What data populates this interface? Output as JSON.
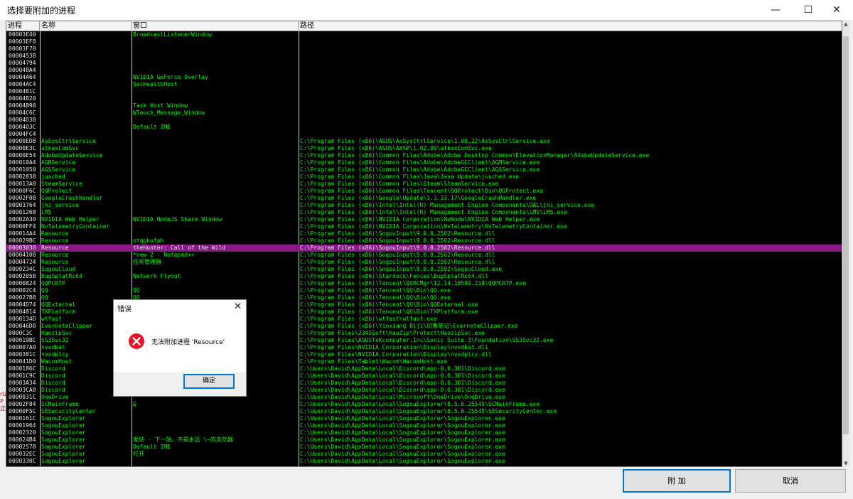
{
  "window": {
    "title": "选择要附加的进程",
    "minimize_glyph": "—",
    "maximize_glyph": "☐",
    "close_glyph": "✕"
  },
  "columns": [
    "进程",
    "名称",
    "窗口",
    "路径"
  ],
  "rows": [
    [
      "00003E40",
      "",
      "BroadcastListenerWindow",
      ""
    ],
    [
      "00003EF8",
      "",
      "",
      ""
    ],
    [
      "00003F70",
      "",
      "",
      ""
    ],
    [
      "00004538",
      "",
      "",
      ""
    ],
    [
      "00004794",
      "",
      "",
      ""
    ],
    [
      "000048A4",
      "",
      "",
      ""
    ],
    [
      "00004A64",
      "",
      "NVIDIA GeForce Overlay",
      ""
    ],
    [
      "00004AC4",
      "",
      "SecHealthHost",
      ""
    ],
    [
      "00004B1C",
      "",
      "",
      ""
    ],
    [
      "00004B20",
      "",
      "",
      ""
    ],
    [
      "00004B98",
      "",
      "Task Host Window",
      ""
    ],
    [
      "00004C6C",
      "",
      "WTouch_Massage_Window",
      ""
    ],
    [
      "00004D38",
      "",
      "",
      ""
    ],
    [
      "00004D3C",
      "",
      "Default IME",
      ""
    ],
    [
      "00004FC4",
      "",
      "",
      ""
    ],
    [
      "00000ED8",
      "AsSysCtrlService",
      "",
      "C:\\Program Files (x86)\\ASUS\\AsSysCtrlService\\1.00.22\\AsSysCtrlService.exe"
    ],
    [
      "00000E3C",
      "atkexComSvc",
      "",
      "C:\\Program Files (x86)\\ASUS\\AXSP\\1.02.00\\atkexComSvc.exe"
    ],
    [
      "00000E54",
      "AdobeUpdateService",
      "",
      "C:\\Program Files (x86)\\Common Files\\Adobe\\Adobe Desktop Common\\ElevationManager\\AdobeUpdateService.exe"
    ],
    [
      "000010A4",
      "AGMService",
      "",
      "C:\\Program Files (x86)\\Common Files\\Adobe\\AdobeGCClient\\AGMService.exe"
    ],
    [
      "00001050",
      "AGSService",
      "",
      "C:\\Program Files (x86)\\Common Files\\Adobe\\AdobeGCClient\\AGSService.exe"
    ],
    [
      "00002838",
      "jusched",
      "",
      "C:\\Program Files (x86)\\Common Files\\Java\\Java Update\\jusched.exe"
    ],
    [
      "000013A0",
      "SteamService",
      "",
      "C:\\Program Files (x86)\\Common Files\\Steam\\SteamService.exe"
    ],
    [
      "00000F6C",
      "QQProtect",
      "",
      "C:\\Program Files (x86)\\Common Files\\Tencent\\QQProtect\\Bin\\QQProtect.exe"
    ],
    [
      "00002F08",
      "GoogleCrashHandler",
      "",
      "C:\\Program Files (x86)\\Google\\Update\\1.3.33.17\\GoogleCrashHandler.exe"
    ],
    [
      "00003764",
      "jhi_service",
      "",
      "C:\\Program Files (x86)\\Intel\\Intel(R) Management Engine Components\\DAL\\jhi_service.exe"
    ],
    [
      "00001268",
      "LMS",
      "",
      "C:\\Program Files (x86)\\Intel\\Intel(R) Management Engine Components\\LMS\\LMS.exe"
    ],
    [
      "00002A30",
      "NVIDIA Web Helper",
      "NVIDIA NodeJS Share Window",
      "C:\\Program Files (x86)\\NVIDIA Corporation\\NvNode\\NVIDIA Web Helper.exe"
    ],
    [
      "00000FF4",
      "NvTelemetryContainer",
      "",
      "C:\\Program Files (x86)\\NVIDIA Corporation\\NvTelemetry\\NvTelemetryContainer.exe"
    ],
    [
      "000014A4",
      "Resource",
      "",
      "C:\\Program Files (x86)\\SogouInput\\9.0.0.2502\\Resource.dll"
    ],
    [
      "000029BC",
      "Resource",
      "otqgkufph",
      "C:\\Program Files (x86)\\SogouInput\\9.0.0.2502\\Resource.dll"
    ],
    [
      "00003030",
      "Resource",
      "theHunter: Call of the Wild",
      "C:\\Program Files (x86)\\SogouInput\\9.0.0.2502\\Resource.dll"
    ],
    [
      "00004108",
      "Resource",
      "*new 2 - Notepad++",
      "C:\\Program Files (x86)\\SogouInput\\9.0.0.2502\\Resource.dll"
    ],
    [
      "00004724",
      "Resource",
      "任务管理器",
      "C:\\Program Files (x86)\\SogouInput\\9.0.0.2502\\Resource.dll"
    ],
    [
      "0000234C",
      "SogouCloud",
      "",
      "C:\\Program Files (x86)\\SogouInput\\9.0.0.2502\\SogouCloud.exe"
    ],
    [
      "00002058",
      "BugSplatRc64",
      "Network Flyout",
      "C:\\Program Files (x86)\\Stardock\\Fences\\BugSplatRc64.dll"
    ],
    [
      "00000824",
      "QQPCRTP",
      "",
      "C:\\Program Files (x86)\\Tencent\\QQPCMgr\\12.14.19590.218\\QQPCRTP.exe"
    ],
    [
      "000002C4",
      "QQ",
      "QQ",
      "C:\\Program Files (x86)\\Tencent\\QQ\\Bin\\QQ.exe"
    ],
    [
      "000027B8",
      "QQ",
      "QQ",
      "C:\\Program Files (x86)\\Tencent\\QQ\\Bin\\QQ.exe"
    ],
    [
      "00004D74",
      "QQExternal",
      "",
      "C:\\Program Files (x86)\\Tencent\\QQ\\Bin\\QQExternal.exe"
    ],
    [
      "00004814",
      "TXPlatform",
      "",
      "C:\\Program Files (x86)\\Tencent\\QQ\\Bin\\TXPlatform.exe"
    ],
    [
      "0000134D",
      "wtfast",
      ".1a2a379.0",
      "C:\\Program Files (x86)\\wtfast\\wtfast.exe"
    ],
    [
      "000046D8",
      "EvernoteClipper",
      "",
      "C:\\Program Files (x86)\\Yinxiang Biji\\印象笔记\\EvernoteClipper.exe"
    ],
    [
      "0000C3C",
      "HaozipSvc",
      "",
      "C:\\Program Files\\2345Soft\\HaoZip\\Protect\\HaozipSvc.exe"
    ],
    [
      "000019BC",
      "SS3Svc32",
      "",
      "C:\\Program Files\\ASUSTeKcomputer.Inc\\Sonic Suite 3\\Foundation\\SS3Svc32.exe"
    ],
    [
      "000007A0",
      "nvxdbat",
      "",
      "C:\\Program Files\\NVIDIA Corporation\\Display\\nvxdbat.dll"
    ],
    [
      "0000381C",
      "nvxdplcy",
      "",
      "C:\\Program Files\\NVIDIA Corporation\\Display\\nvxdplcy.dll"
    ],
    [
      "000041D0",
      "WacomHost",
      "",
      "C:\\Program Files\\Tablet\\Wacom\\WacomHost.exe"
    ],
    [
      "0000186C",
      "Discord",
      "",
      "C:\\Users\\David\\AppData\\Local\\Discord\\app-0.0.301\\Discord.exe"
    ],
    [
      "00001C9C",
      "Discord",
      "",
      "C:\\Users\\David\\AppData\\Local\\Discord\\app-0.0.301\\Discord.exe"
    ],
    [
      "00003A34",
      "Discord",
      "",
      "C:\\Users\\David\\AppData\\Local\\Discord\\app-0.0.301\\Discord.exe"
    ],
    [
      "00003CA8",
      "Discord",
      "",
      "C:\\Users\\David\\AppData\\Local\\Discord\\app-0.0.301\\Discord.exe"
    ],
    [
      "0000031C",
      "OneDrive",
      "",
      "C:\\Users\\David\\AppData\\Local\\Microsoft\\OneDrive\\OneDrive.exe"
    ],
    [
      "00002F84",
      "SCMainFrame",
      "G",
      "C:\\Users\\David\\AppData\\Local\\SogouExplorer\\8.5.6.25545\\SCMainFrame.exe"
    ],
    [
      "00000F5C",
      "SESecurityCenter",
      "",
      "C:\\Users\\David\\AppData\\Local\\SogouExplorer\\8.5.6.25545\\SESecurityCenter.exe"
    ],
    [
      "0000161C",
      "SogouExplorer",
      "",
      "C:\\Users\\David\\AppData\\Local\\SogouExplorer\\SogouExplorer.exe"
    ],
    [
      "00001964",
      "SogouExplorer",
      "",
      "C:\\Users\\David\\AppData\\Local\\SogouExplorer\\SogouExplorer.exe"
    ],
    [
      "00002320",
      "SogouExplorer",
      "",
      "C:\\Users\\David\\AppData\\Local\\SogouExplorer\\SogouExplorer.exe"
    ],
    [
      "000024B4",
      "SogouExplorer",
      "发帖 - 下一站、不是永远 \\~的浏览器",
      "C:\\Users\\David\\AppData\\Local\\SogouExplorer\\SogouExplorer.exe"
    ],
    [
      "00002578",
      "SogouExplorer",
      "Default IME",
      "C:\\Users\\David\\AppData\\Local\\SogouExplorer\\SogouExplorer.exe"
    ],
    [
      "000032EC",
      "SogouExplorer",
      "打开",
      "C:\\Users\\David\\AppData\\Local\\SogouExplorer\\SogouExplorer.exe"
    ],
    [
      "0000330C",
      "SogouExplorer",
      "",
      "C:\\Users\\David\\AppData\\Local\\SogouExplorer\\SogouExplorer.exe"
    ]
  ],
  "selected_row": 30,
  "buttons": {
    "attach": "附 加",
    "cancel": "取消"
  },
  "dialog": {
    "title": "错误",
    "close_glyph": "✕",
    "message": "无法附加进程 'Resource'",
    "ok": "确定"
  },
  "left_edge_text": "rU\nP\n正",
  "colors": {
    "grid_bg": "#000000",
    "text_green": "#00ff00",
    "selection": "#8a1a8a",
    "error_red": "#e81123",
    "focus_blue": "#0078d7"
  },
  "icons": {
    "error": "error-x-icon"
  }
}
